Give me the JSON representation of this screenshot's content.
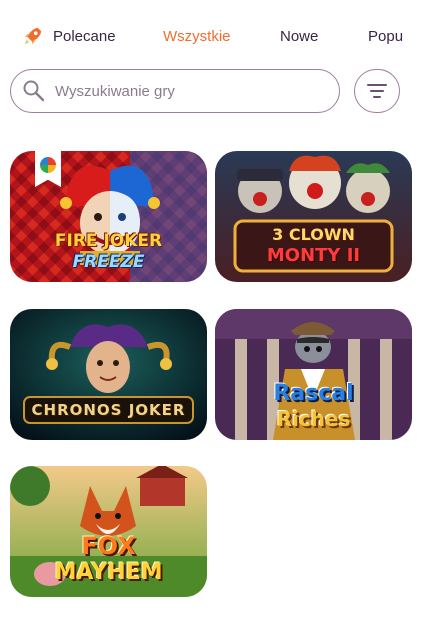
{
  "tabs": [
    {
      "label": "Polecane",
      "icon": "rocket-icon",
      "active": false
    },
    {
      "label": "Wszystkie",
      "active": true
    },
    {
      "label": "Nowe",
      "active": false
    },
    {
      "label": "Popu",
      "active": false
    }
  ],
  "search": {
    "placeholder": "Wyszukiwanie gry",
    "icon": "search-icon"
  },
  "filter": {
    "icon": "filter-icon"
  },
  "games": [
    {
      "title_line1": "FIRE JOKER",
      "title_line2": "FREEZE",
      "badge": true
    },
    {
      "title_line1": "3 CLOWN",
      "title_line2": "MONTY II"
    },
    {
      "title_line1": "CHRONOS JOKER"
    },
    {
      "title_line1": "Rascal",
      "title_line2": "Riches"
    },
    {
      "title_line1": "FOX",
      "title_line2": "MAYHEM"
    }
  ],
  "colors": {
    "accent": "#f26d2c",
    "text": "#3b2444",
    "border": "#9e7e9b"
  }
}
